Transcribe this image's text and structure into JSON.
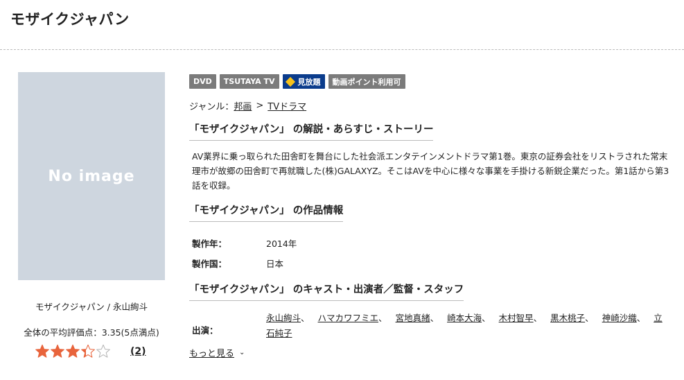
{
  "header": {
    "title": "モザイクジャパン"
  },
  "cover": {
    "no_image_text": "No image",
    "caption": "モザイクジャパン / 永山絢斗"
  },
  "rating": {
    "text": "全体の平均評価点：3.35(5点満点)",
    "score": 3.35,
    "max": 5,
    "review_count": "(2)"
  },
  "badges": [
    {
      "label": "DVD"
    },
    {
      "label": "TSUTAYA TV"
    },
    {
      "label": "見放題",
      "icon": "diamond-icon"
    },
    {
      "label": "動画ポイント利用可"
    }
  ],
  "genre": {
    "label": "ジャンル：",
    "items": [
      "邦画",
      "TVドラマ"
    ],
    "separator": ">"
  },
  "sections": {
    "description": {
      "heading": "「モザイクジャパン」 の解説・あらすじ・ストーリー",
      "text": "AV業界に乗っ取られた田舎町を舞台にした社会派エンタテインメントドラマ第1巻。東京の証券会社をリストラされた常末理市が故郷の田舎町で再就職した(株)GALAXYZ。そこはAVを中心に様々な事業を手掛ける新鋭企業だった。第1話から第3話を収録。"
    },
    "info": {
      "heading": "「モザイクジャパン」 の作品情報",
      "rows": [
        {
          "label": "製作年：",
          "value": "2014年"
        },
        {
          "label": "製作国：",
          "value": "日本"
        }
      ]
    },
    "cast": {
      "heading": "「モザイクジャパン」 のキャスト・出演者／監督・スタッフ",
      "label": "出演：",
      "names": [
        "永山絢斗",
        "ハマカワフミエ",
        "宮地真緒",
        "崎本大海",
        "木村智早",
        "黒木桃子",
        "神崎沙織",
        "立石純子"
      ],
      "comma": "、",
      "more_label": "もっと見る"
    }
  },
  "colors": {
    "star": "#e8643c",
    "cover_bg": "#ced6df",
    "badge_gray": "#7b7b7b",
    "badge_blue": "#0b3c8c"
  }
}
